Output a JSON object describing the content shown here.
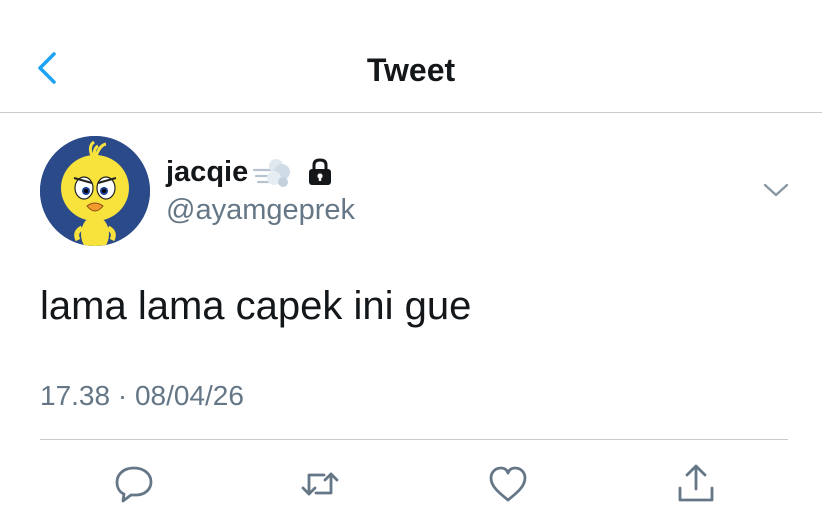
{
  "header": {
    "title": "Tweet",
    "back_icon": "chevron-left-icon"
  },
  "author": {
    "display_name": "jacqie",
    "handle": "@ayamgeprek",
    "badge_emoji": "dash-emoji",
    "protected_icon": "lock-icon",
    "avatar": "tweety-bird-avatar"
  },
  "tweet": {
    "text": "lama lama capek ini gue",
    "timestamp": "17.38 · 08/04/26"
  },
  "actions": {
    "reply_icon": "reply-icon",
    "retweet_icon": "retweet-icon",
    "like_icon": "heart-icon",
    "share_icon": "share-icon"
  },
  "colors": {
    "accent": "#1da1f2",
    "text_primary": "#14171a",
    "text_secondary": "#657786",
    "divider": "#c8ccd0"
  }
}
